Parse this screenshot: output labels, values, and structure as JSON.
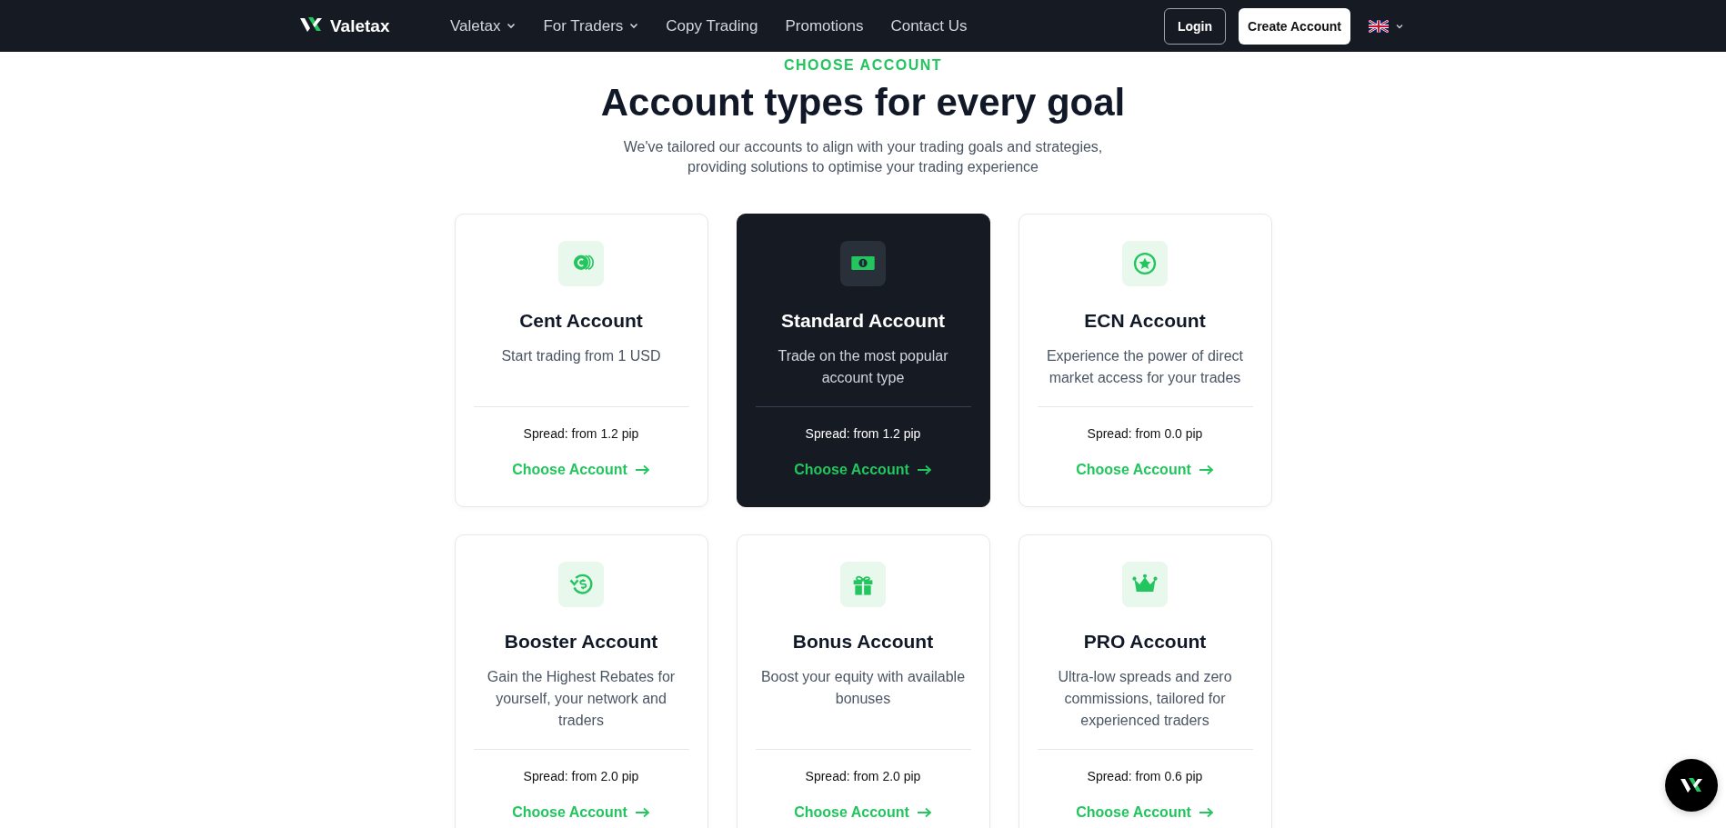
{
  "navbar": {
    "brand": "Valetax",
    "links": [
      {
        "label": "Valetax",
        "has_menu": true
      },
      {
        "label": "For Traders",
        "has_menu": true
      },
      {
        "label": "Copy Trading",
        "has_menu": false
      },
      {
        "label": "Promotions",
        "has_menu": false
      },
      {
        "label": "Contact Us",
        "has_menu": false
      }
    ],
    "login": "Login",
    "create_account": "Create Account"
  },
  "section": {
    "eyebrow": "CHOOSE ACCOUNT",
    "title": "Account types for every goal",
    "subtitle": "We've tailored our accounts to align with your trading goals and strategies, providing solutions to optimise your trading experience"
  },
  "cards": [
    {
      "title": "Cent Account",
      "description": "Start trading from 1 USD",
      "spread": "Spread: from 1.2 pip",
      "link": "Choose Account",
      "selected": false
    },
    {
      "title": "Standard Account",
      "description": "Trade on the most popular account type",
      "spread": "Spread: from 1.2 pip",
      "link": "Choose Account",
      "selected": true
    },
    {
      "title": "ECN Account",
      "description": "Experience the power of direct market access for your trades",
      "spread": "Spread: from 0.0 pip",
      "link": "Choose Account",
      "selected": false
    },
    {
      "title": "Booster Account",
      "description": "Gain the Highest Rebates for yourself, your network and traders",
      "spread": "Spread: from 2.0 pip",
      "link": "Choose Account",
      "selected": false
    },
    {
      "title": "Bonus Account",
      "description": "Boost your equity with available bonuses",
      "spread": "Spread: from 2.0 pip",
      "link": "Choose Account",
      "selected": false
    },
    {
      "title": "PRO Account",
      "description": "Ultra-low spreads and zero commissions, tailored for experienced traders",
      "spread": "Spread: from 0.6 pip",
      "link": "Choose Account",
      "selected": false
    }
  ]
}
